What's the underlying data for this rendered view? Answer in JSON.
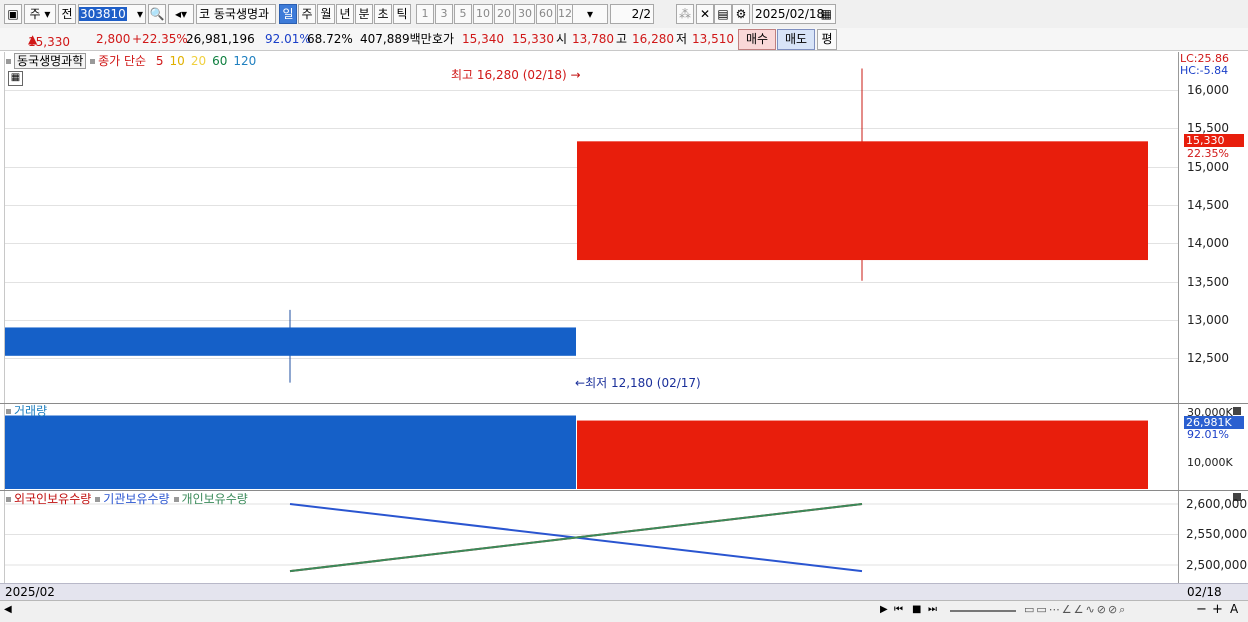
{
  "toolbar": {
    "market": "주",
    "prev": "전",
    "code": "303810",
    "name": "동국생명과",
    "name_prefix": "코",
    "periods": [
      "일",
      "주",
      "월",
      "년",
      "분",
      "초",
      "틱"
    ],
    "selected_period": "일",
    "intervals": [
      "1",
      "3",
      "5",
      "10",
      "20",
      "30",
      "60",
      "120"
    ],
    "page": "2",
    "page_total": "/2",
    "date": "2025/02/18"
  },
  "info": {
    "price": "15,330",
    "change": "2,800",
    "change_pct": "+22.35%",
    "volume": "26,981,196",
    "vol_ratio": "92.01%",
    "turnover": "68.72%",
    "amount": "407,889백만",
    "quote_label": "호가",
    "ask": "15,340",
    "bid": "15,330",
    "open_label": "시",
    "open": "13,780",
    "high_label": "고",
    "high": "16,280",
    "low_label": "저",
    "low": "13,510",
    "buy": "매수",
    "sell": "매도",
    "eval": "평"
  },
  "price_panel": {
    "stock": "동국생명과학",
    "legend_title": "종가 단순",
    "ma": [
      {
        "label": "5",
        "color": "#d01818"
      },
      {
        "label": "10",
        "color": "#e0b000"
      },
      {
        "label": "20",
        "color": "#f0d040"
      },
      {
        "label": "60",
        "color": "#108040"
      },
      {
        "label": "120",
        "color": "#2080c0"
      }
    ],
    "lc": "LC:25.86",
    "hc": "HC:-5.84",
    "high_note": "최고 16,280 (02/18)",
    "low_note": "최저 12,180 (02/17)",
    "current": "15,330",
    "current_pct": "22.35%",
    "yticks": [
      "16,000",
      "15,500",
      "15,000",
      "14,500",
      "14,000",
      "13,500",
      "13,000",
      "12,500"
    ]
  },
  "volume_panel": {
    "title": "거래량",
    "current": "26,981K",
    "pct": "92.01%",
    "yticks": [
      "30,000K",
      "10,000K"
    ]
  },
  "holdings_panel": {
    "series": [
      {
        "name": "외국인보유수량",
        "color": "#c01010"
      },
      {
        "name": "기관보유수량",
        "color": "#2a55d0"
      },
      {
        "name": "개인보유수량",
        "color": "#3a8a5a"
      }
    ],
    "yticks": [
      "2,600,000",
      "2,550,000",
      "2,500,000"
    ]
  },
  "bottom": {
    "left": "2025/02",
    "right": "02/18"
  },
  "chart_data": {
    "type": "candlestick",
    "candles": [
      {
        "date": "02/17",
        "open": 12900,
        "high": 13130,
        "low": 12180,
        "close": 12530,
        "color": "#1560c8"
      },
      {
        "date": "02/18",
        "open": 13780,
        "high": 16280,
        "low": 13510,
        "close": 15330,
        "color": "#e81e0c"
      }
    ],
    "ylim": [
      12180,
      16280
    ],
    "volume": [
      {
        "date": "02/17",
        "value": 29000000,
        "color": "#1560c8"
      },
      {
        "date": "02/18",
        "value": 26981196,
        "color": "#e81e0c"
      }
    ],
    "holdings": {
      "외국인보유수량": [
        2490000,
        2600000
      ],
      "기관보유수량": [
        2600000,
        2490000
      ],
      "개인보유수량": [
        2490000,
        2600000
      ]
    }
  }
}
